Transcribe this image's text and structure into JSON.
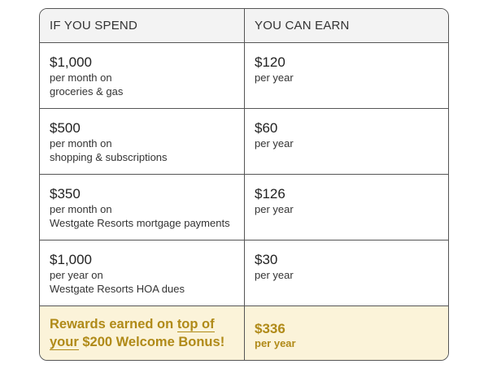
{
  "table": {
    "headers": {
      "spend": "IF YOU SPEND",
      "earn": "YOU CAN EARN"
    },
    "rows": [
      {
        "spend_amount": "$1,000",
        "spend_line1": "per month on",
        "spend_line2": "groceries & gas",
        "earn_amount": "$120",
        "earn_period": "per year"
      },
      {
        "spend_amount": "$500",
        "spend_line1": "per month on",
        "spend_line2": "shopping & subscriptions",
        "earn_amount": "$60",
        "earn_period": "per year"
      },
      {
        "spend_amount": "$350",
        "spend_line1": "per month on",
        "spend_line2": "Westgate Resorts mortgage payments",
        "earn_amount": "$126",
        "earn_period": "per year"
      },
      {
        "spend_amount": "$1,000",
        "spend_line1": "per year on",
        "spend_line2": "Westgate Resorts HOA dues",
        "earn_amount": "$30",
        "earn_period": "per year"
      }
    ],
    "total": {
      "text_part1": "Rewards earned on ",
      "text_underlined1": "top of",
      "text_underlined2": "your",
      "text_part2": " $200 Welcome Bonus!",
      "amount": "$336",
      "period": "per year"
    }
  },
  "colors": {
    "border": "#555555",
    "header_bg": "#f3f3f3",
    "total_bg": "#fbf3d9",
    "accent_gold": "#b08a18"
  }
}
